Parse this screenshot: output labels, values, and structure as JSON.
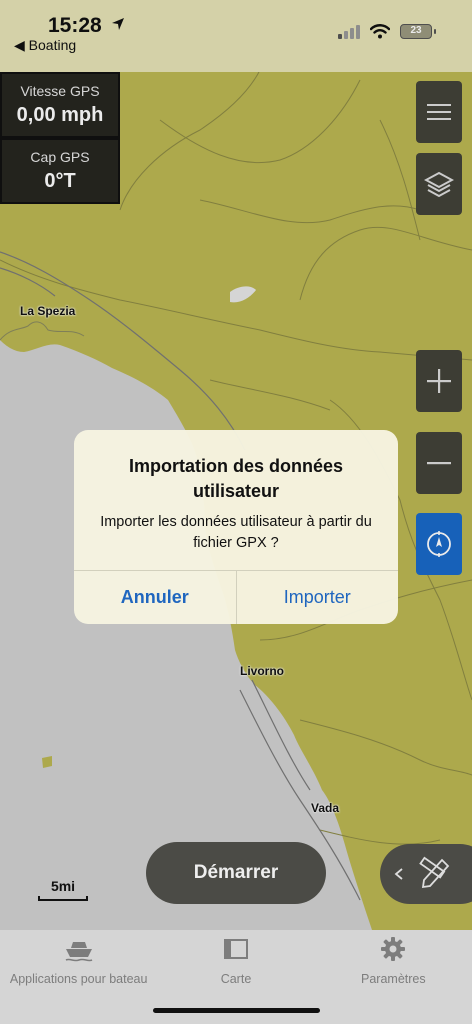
{
  "statusbar": {
    "time": "15:28",
    "back_app": "◀ Boating",
    "battery": "23"
  },
  "gps": {
    "speed_label": "Vitesse GPS",
    "speed_value": "0,00 mph",
    "heading_label": "Cap GPS",
    "heading_value": "0°T"
  },
  "map": {
    "places": [
      "La Spezia",
      "Livorno",
      "Vada"
    ],
    "land_color": "#bcb853",
    "water_color": "#d2d2d2"
  },
  "dialog": {
    "title": "Importation des données utilisateur",
    "message": "Importer les données utilisateur à partir du fichier GPX ?",
    "cancel": "Annuler",
    "confirm": "Importer"
  },
  "controls": {
    "start": "Démarrer",
    "scale": "5mi"
  },
  "tabs": [
    {
      "label": "Applications pour bateau",
      "icon": "boat-icon"
    },
    {
      "label": "Carte",
      "icon": "map-icon"
    },
    {
      "label": "Paramètres",
      "icon": "gear-icon"
    }
  ]
}
